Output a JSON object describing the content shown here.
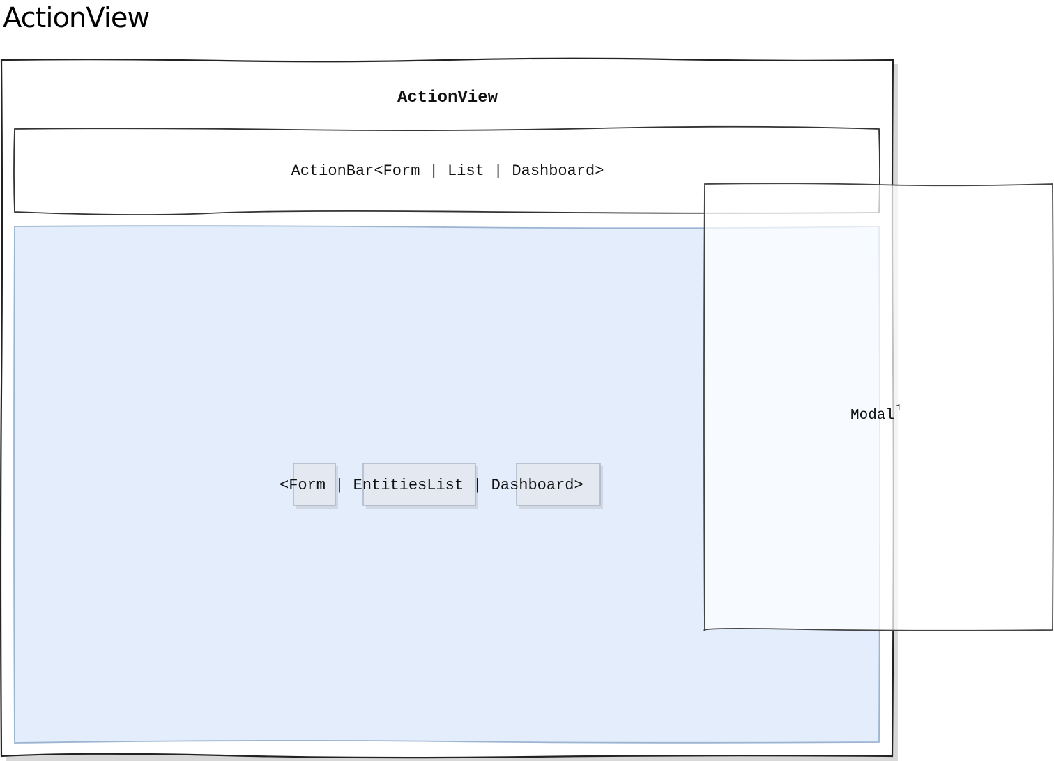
{
  "page": {
    "heading": "ActionView"
  },
  "action_view": {
    "title": "ActionView"
  },
  "action_bar": {
    "label": "ActionBar<Form | List | Dashboard>"
  },
  "content": {
    "label": "<Form | EntitiesList | Dashboard>",
    "fill_color": "#e3edfb",
    "stroke_color": "#9bb4d1"
  },
  "modal": {
    "label": "Modal",
    "superscript": "1"
  }
}
